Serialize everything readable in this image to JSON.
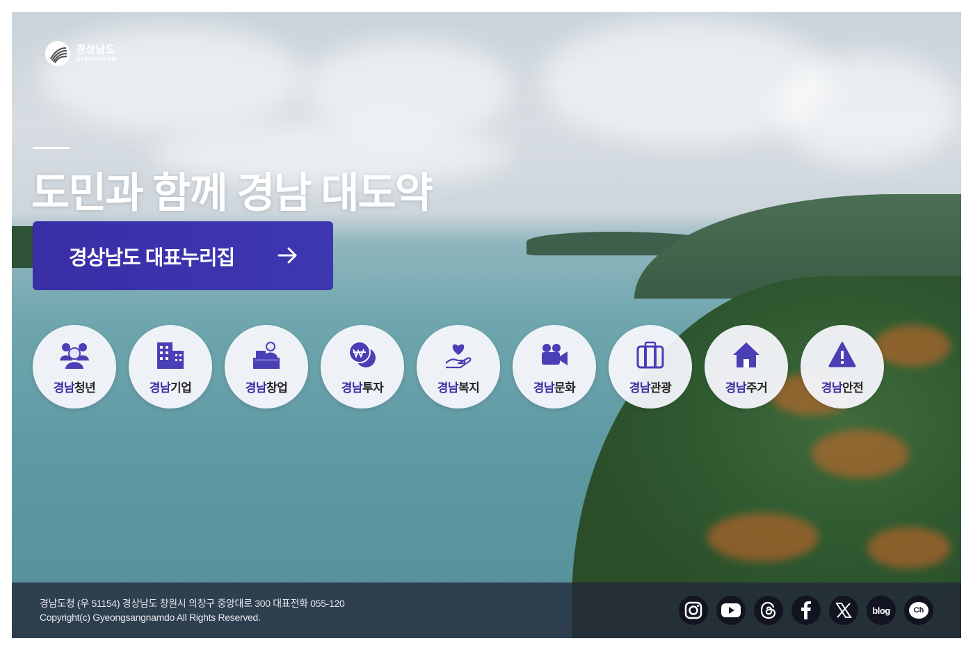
{
  "brand": {
    "name_ko": "경상남도",
    "name_en": "GYEONGNAM"
  },
  "hero": {
    "headline": "도민과 함께 경남 대도약",
    "cta_label": "경상남도 대표누리집"
  },
  "menu": [
    {
      "prefix": "경남",
      "suffix": "청년",
      "icon": "youth-people-icon"
    },
    {
      "prefix": "경남",
      "suffix": "기업",
      "icon": "building-icon"
    },
    {
      "prefix": "경남",
      "suffix": "창업",
      "icon": "startup-desk-icon"
    },
    {
      "prefix": "경남",
      "suffix": "투자",
      "icon": "won-coin-icon"
    },
    {
      "prefix": "경남",
      "suffix": "복지",
      "icon": "heart-hand-icon"
    },
    {
      "prefix": "경남",
      "suffix": "문화",
      "icon": "video-camera-icon"
    },
    {
      "prefix": "경남",
      "suffix": "관광",
      "icon": "suitcase-icon"
    },
    {
      "prefix": "경남",
      "suffix": "주거",
      "icon": "house-icon"
    },
    {
      "prefix": "경남",
      "suffix": "안전",
      "icon": "warning-icon"
    }
  ],
  "footer": {
    "address": "경남도청 (우 51154) 경상남도 창원시 의창구 중앙대로 300 대표전화 055-120",
    "copyright": "Copyright(c) Gyeongsangnamdo All Rights Reserved."
  },
  "social": [
    {
      "name": "instagram-icon"
    },
    {
      "name": "youtube-icon"
    },
    {
      "name": "threads-icon"
    },
    {
      "name": "facebook-icon"
    },
    {
      "name": "x-icon",
      "label": "X"
    },
    {
      "name": "blog-icon",
      "label": "blog"
    },
    {
      "name": "kakao-channel-icon",
      "label": "Ch"
    }
  ],
  "colors": {
    "accent": "#3b2ea6",
    "cta_background": "#3a2ea6",
    "footer_background": "#22283a"
  }
}
